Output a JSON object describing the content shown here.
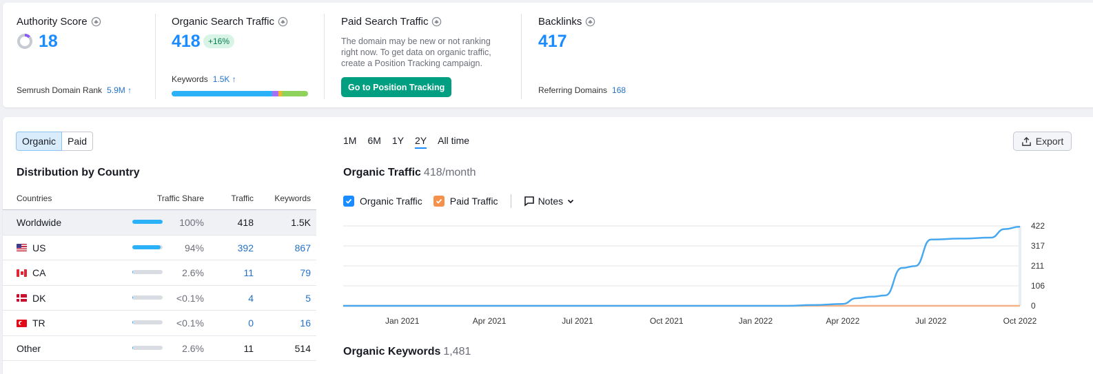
{
  "summary": {
    "authority": {
      "title": "Authority Score",
      "value": "18",
      "rank_label": "Semrush Domain Rank",
      "rank_value": "5.9M"
    },
    "organic": {
      "title": "Organic Search Traffic",
      "value": "418",
      "growth": "+16%",
      "keywords_label": "Keywords",
      "keywords_value": "1.5K"
    },
    "paid": {
      "title": "Paid Search Traffic",
      "description": "The domain may be new or not ranking right now. To get data on organic traffic, create a Position Tracking campaign.",
      "button": "Go to Position Tracking"
    },
    "backlinks": {
      "title": "Backlinks",
      "value": "417",
      "referring_label": "Referring Domains",
      "referring_value": "168"
    }
  },
  "tabs": {
    "organic": "Organic",
    "paid": "Paid"
  },
  "distribution": {
    "title": "Distribution by Country",
    "headers": {
      "countries": "Countries",
      "share": "Traffic Share",
      "traffic": "Traffic",
      "keywords": "Keywords"
    },
    "rows": [
      {
        "name": "Worldwide",
        "share": "100%",
        "share_value": 1.0,
        "traffic": "418",
        "keywords": "1.5K"
      },
      {
        "name": "US",
        "share": "94%",
        "share_value": 0.94,
        "traffic": "392",
        "keywords": "867"
      },
      {
        "name": "CA",
        "share": "2.6%",
        "share_value": 0.026,
        "traffic": "11",
        "keywords": "79"
      },
      {
        "name": "DK",
        "share": "<0.1%",
        "share_value": 0.001,
        "traffic": "4",
        "keywords": "5"
      },
      {
        "name": "TR",
        "share": "<0.1%",
        "share_value": 0.001,
        "traffic": "0",
        "keywords": "16"
      },
      {
        "name": "Other",
        "share": "2.6%",
        "share_value": 0.026,
        "traffic": "11",
        "keywords": "514"
      }
    ]
  },
  "periods": [
    "1M",
    "6M",
    "1Y",
    "2Y",
    "All time"
  ],
  "selected_period": "2Y",
  "export_label": "Export",
  "organic_traffic": {
    "title": "Organic Traffic",
    "subtitle": "418/month"
  },
  "legend": {
    "organic": "Organic Traffic",
    "paid": "Paid Traffic",
    "notes": "Notes"
  },
  "organic_keywords": {
    "title": "Organic Keywords",
    "subtitle": "1,481"
  },
  "colors": {
    "accent": "#1a8cff",
    "organic_line": "#47a8f0",
    "paid_line": "#f7b187",
    "button_green": "#009f81"
  },
  "chart_data": {
    "type": "line",
    "x_ticks": [
      "Jan 2021",
      "Apr 2021",
      "Jul 2021",
      "Oct 2021",
      "Jan 2022",
      "Apr 2022",
      "Jul 2022",
      "Oct 2022"
    ],
    "y_ticks": [
      "422",
      "317",
      "211",
      "106",
      "0"
    ],
    "ylim": [
      0,
      422
    ],
    "series": [
      {
        "name": "Organic Traffic",
        "x": [
          "2020-11",
          "2021-01",
          "2021-04",
          "2021-07",
          "2021-10",
          "2022-01",
          "2022-02",
          "2022-03",
          "2022-04",
          "2022-04-15",
          "2022-05",
          "2022-05-15",
          "2022-06",
          "2022-06-15",
          "2022-07",
          "2022-08",
          "2022-09",
          "2022-09-15",
          "2022-10"
        ],
        "values": [
          0,
          0,
          0,
          0,
          0,
          0,
          0,
          4,
          10,
          40,
          48,
          55,
          200,
          210,
          350,
          355,
          360,
          405,
          418
        ]
      },
      {
        "name": "Paid Traffic",
        "x": [
          "2020-11",
          "2022-10"
        ],
        "values": [
          0,
          0
        ]
      }
    ]
  }
}
